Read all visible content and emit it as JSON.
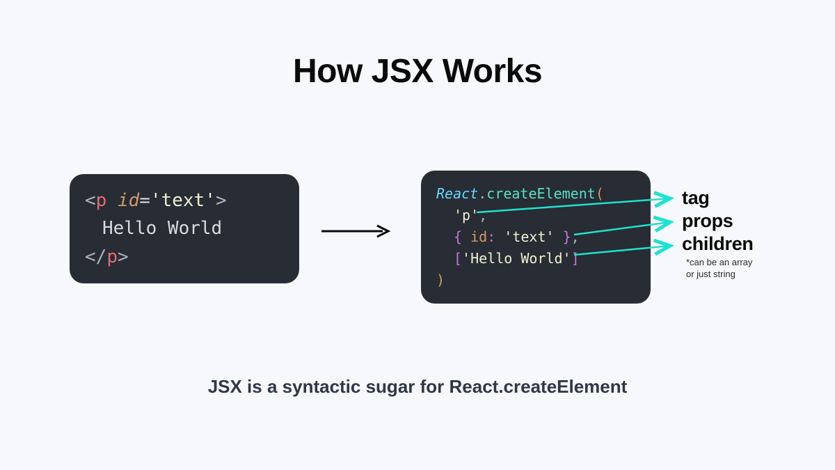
{
  "title": "How JSX Works",
  "subtitle": "JSX is a syntactic sugar for React.createElement",
  "jsx_block": {
    "line1": {
      "open": "<",
      "tag": "p ",
      "attr": "id",
      "eq": "=",
      "val": "'text'",
      "close": ">"
    },
    "line2": "Hello World",
    "line3": {
      "open": "</",
      "tag": "p",
      "close": ">"
    }
  },
  "react_block": {
    "line1": {
      "class": "React",
      "dot": ".",
      "method": "createElement",
      "paren": "("
    },
    "line2": {
      "val": "'p'",
      "comma": ","
    },
    "line3": {
      "open": "{ ",
      "key": "id",
      "colon": ": ",
      "val": "'text'",
      "close": " }",
      "comma": ","
    },
    "line4": {
      "open": "[",
      "val": "'Hello World'",
      "close": "]"
    },
    "line5": ")"
  },
  "labels": {
    "tag": "tag",
    "props": "props",
    "children": "children",
    "footnote1": "*can be an array",
    "footnote2": "or just string"
  },
  "colors": {
    "arrow_cyan": "#1de2d1",
    "arrow_black": "#0a0a0a"
  }
}
